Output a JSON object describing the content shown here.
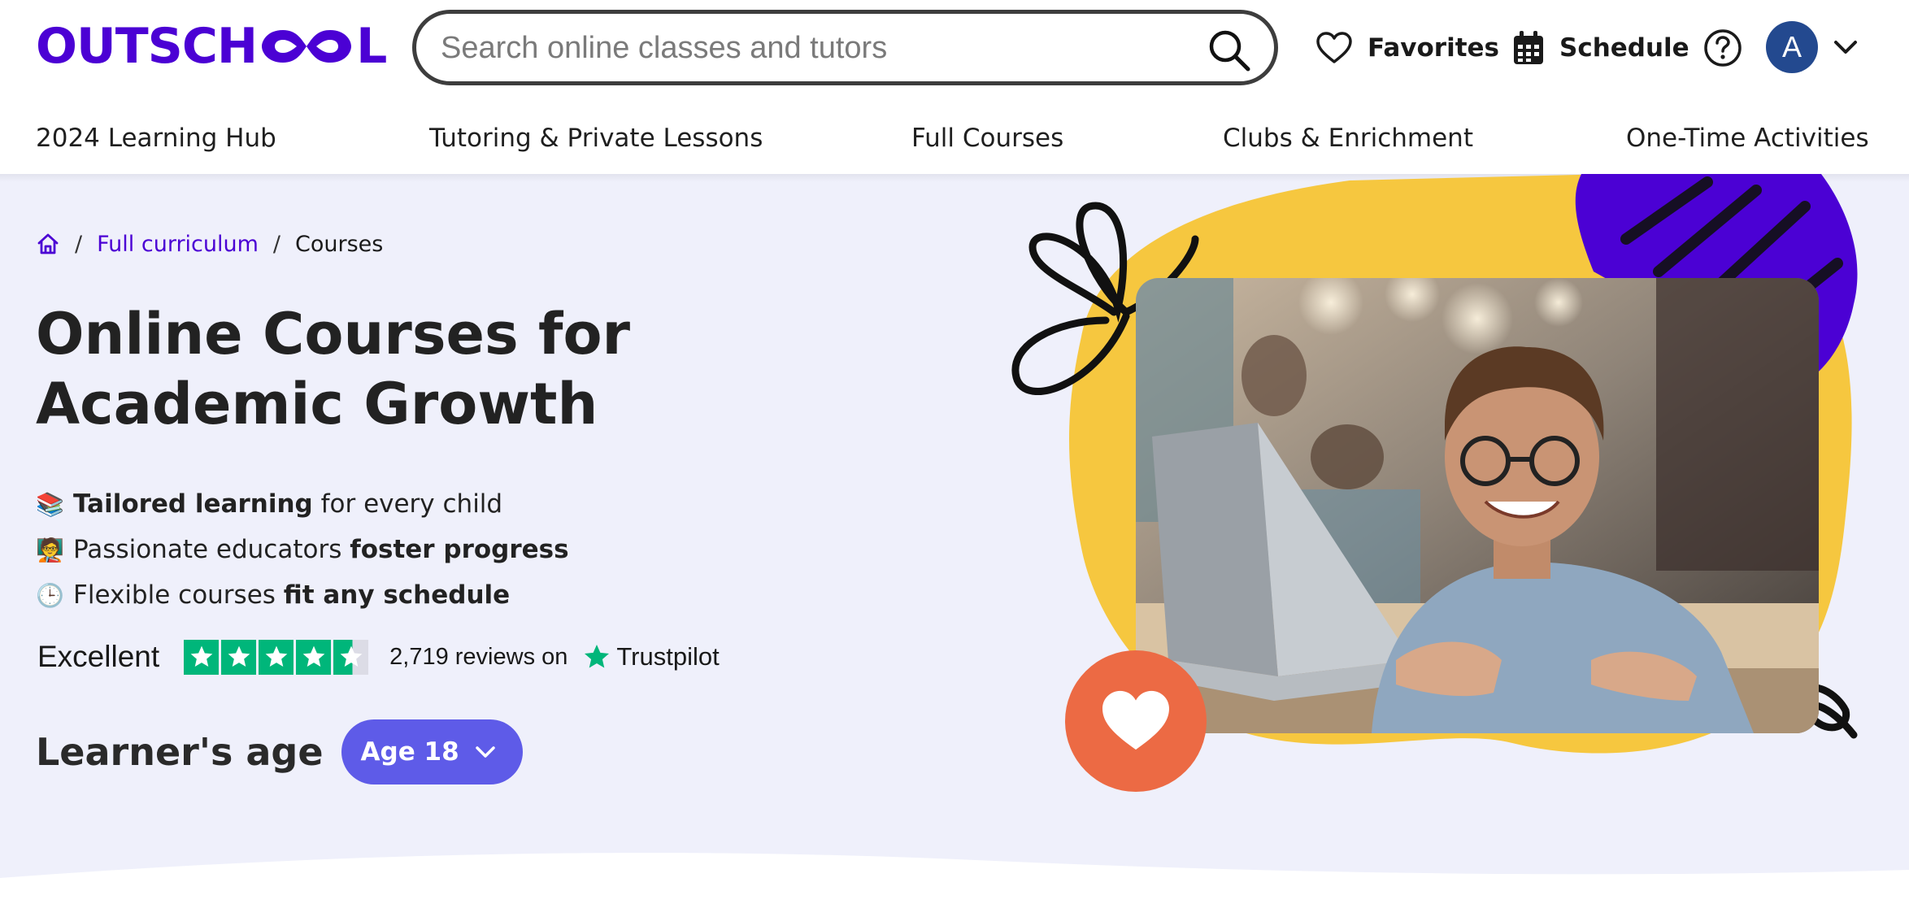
{
  "brand": {
    "logo_text_left": "OUTSCH",
    "logo_text_right": "L",
    "accent": "#4b01d4"
  },
  "search": {
    "placeholder": "Search online classes and tutors",
    "value": ""
  },
  "header": {
    "favorites_label": "Favorites",
    "schedule_label": "Schedule",
    "avatar_initial": "A"
  },
  "categories": [
    {
      "label": "2024 Learning Hub"
    },
    {
      "label": "Tutoring & Private Lessons"
    },
    {
      "label": "Full Courses"
    },
    {
      "label": "Clubs & Enrichment"
    },
    {
      "label": "One-Time Activities"
    }
  ],
  "breadcrumb": {
    "item1": "Full curriculum",
    "item2": "Courses"
  },
  "hero": {
    "title": "Online Courses for Academic Growth",
    "bullets": [
      {
        "emoji": "📚",
        "bold_first": "Tailored learning",
        "rest": " for every child"
      },
      {
        "emoji": "🧑‍🏫",
        "plain_first": "Passionate educators ",
        "bold_last": "foster progress"
      },
      {
        "emoji": "🕒",
        "plain_first": "Flexible courses ",
        "bold_last": "fit any schedule"
      }
    ],
    "trust": {
      "rating_label": "Excellent",
      "stars": 4.5,
      "reviews_text": "2,719 reviews on",
      "provider": "Trustpilot"
    },
    "age": {
      "label": "Learner's age",
      "selected": "Age 18"
    }
  },
  "colors": {
    "hero_bg": "#eff0fb",
    "yellow_blob": "#f6c73f",
    "purple_blob": "#4b01d4",
    "heart_badge": "#ec6a44",
    "age_button": "#5e5be8",
    "trustpilot_green": "#00b67a"
  }
}
